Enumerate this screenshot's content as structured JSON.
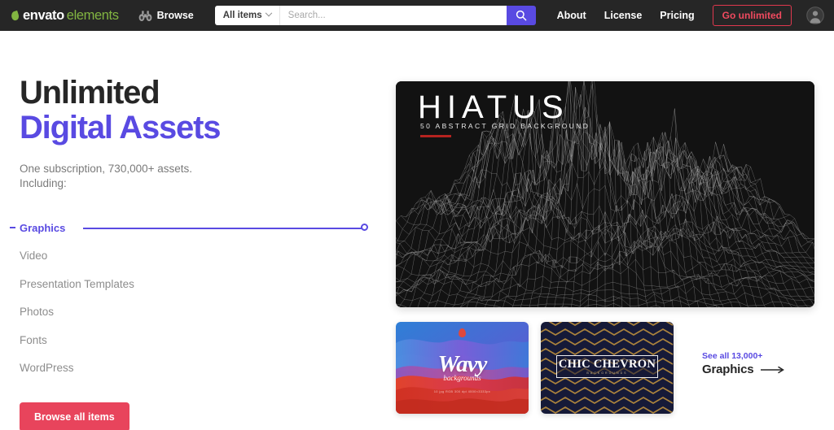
{
  "header": {
    "logo": {
      "primary": "envato",
      "secondary": "elements",
      "leaf_color": "#82b541"
    },
    "browse": {
      "label": "Browse",
      "icon": "binoculars-icon"
    },
    "search": {
      "category_label": "All items",
      "placeholder": "Search...",
      "value": "",
      "button_icon": "search-icon",
      "button_color": "#594ae2"
    },
    "nav": [
      {
        "label": "About"
      },
      {
        "label": "License"
      },
      {
        "label": "Pricing"
      }
    ],
    "cta": {
      "label": "Go unlimited",
      "color": "#f04a5f",
      "border_color": "#e0384e"
    },
    "account": {
      "icon": "user-avatar-icon"
    }
  },
  "hero": {
    "title_line1": "Unlimited",
    "title_line2": "Digital Assets",
    "subtitle_line1": "One subscription, 730,000+ assets.",
    "subtitle_line2": "Including:",
    "accent_color": "#594ae2",
    "categories": [
      {
        "label": "Graphics",
        "active": true
      },
      {
        "label": "Video",
        "active": false
      },
      {
        "label": "Presentation Templates",
        "active": false
      },
      {
        "label": "Photos",
        "active": false
      },
      {
        "label": "Fonts",
        "active": false
      },
      {
        "label": "WordPress",
        "active": false
      }
    ],
    "browse_all_label": "Browse all items",
    "browse_all_color": "#e8445c"
  },
  "showcase": {
    "featured": {
      "title": "HIATUS",
      "subtitle": "50 ABSTRACT GRID BACKGROUND",
      "rule_color": "#b5231f",
      "background_color": "#141414",
      "artwork": "wireframe-terrain"
    },
    "thumbnails": [
      {
        "name": "wavy-backgrounds-thumbnail",
        "title": "Wavy",
        "subtitle": "backgrounds",
        "specs": "10 jpg  RGB  300 dpi\n4500×3333px",
        "artwork": "gradient-waves"
      },
      {
        "name": "chic-chevron-thumbnail",
        "title": "CHIC CHEVRON",
        "subtitle": "BACKGROUNDS",
        "artwork": "gold-chevron-pattern"
      }
    ],
    "see_all": {
      "top_label": "See all 13,000+",
      "bottom_label": "Graphics",
      "arrow_icon": "arrow-right-icon",
      "top_color": "#594ae2"
    }
  }
}
